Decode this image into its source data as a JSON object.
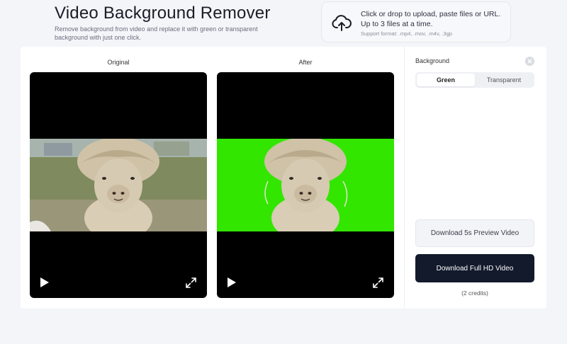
{
  "header": {
    "title": "Video Background Remover",
    "description": "Remove background from video and replace it with green or transparent background with just one click."
  },
  "upload": {
    "line1": "Click or drop to upload, paste files or URL.",
    "line2": "Up to 3 files at a time.",
    "formats": "Support format: .mp4, .mov, .m4v, .3gp",
    "icon": "upload-cloud-icon"
  },
  "preview": {
    "original_label": "Original",
    "after_label": "After",
    "after_background_color": "#33e600"
  },
  "sidebar": {
    "background_label": "Background",
    "options": [
      "Green",
      "Transparent"
    ],
    "selected": "Green",
    "download_preview": "Download 5s Preview Video",
    "download_full": "Download Full HD Video",
    "credits": "(2 credits)"
  },
  "colors": {
    "primary_button": "#121a2b",
    "green_screen": "#33e600"
  }
}
